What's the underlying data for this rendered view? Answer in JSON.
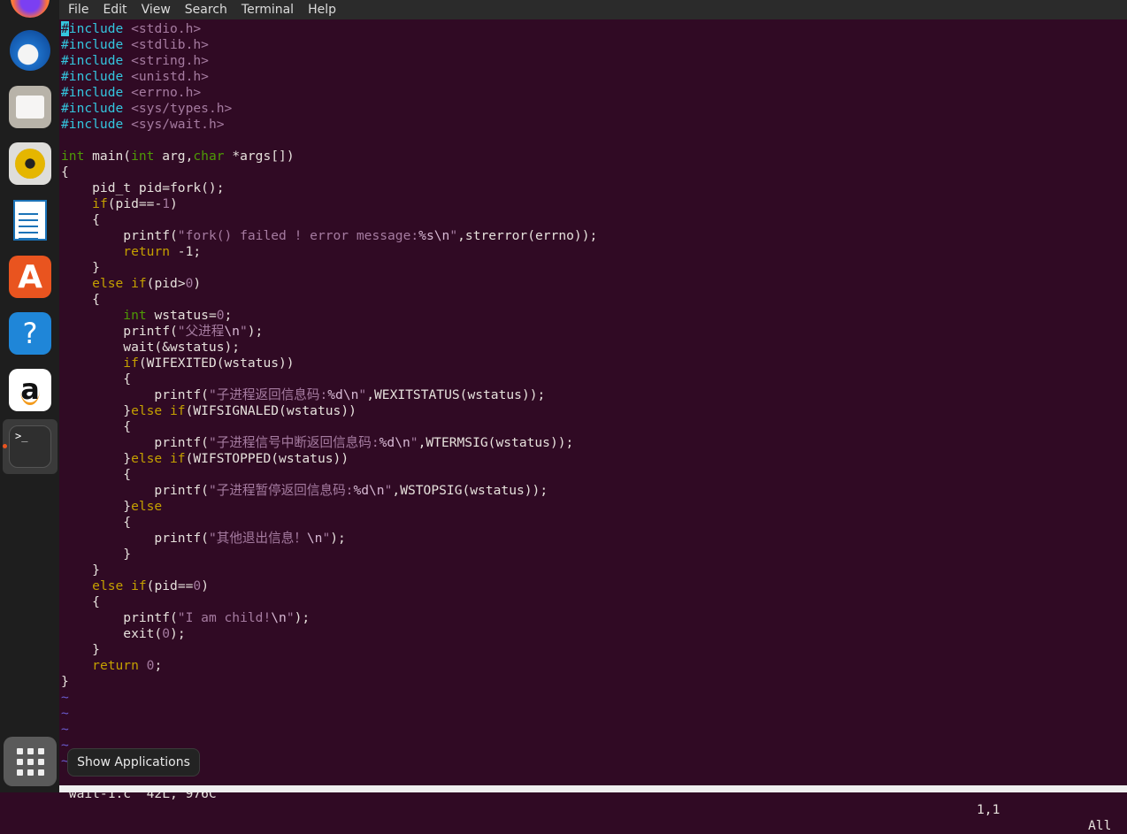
{
  "menubar": {
    "items": [
      "File",
      "Edit",
      "View",
      "Search",
      "Terminal",
      "Help"
    ]
  },
  "dock": {
    "items": [
      {
        "name": "firefox",
        "icon": "firefox-icon"
      },
      {
        "name": "thunderbird",
        "icon": "thunderbird-mail-icon"
      },
      {
        "name": "files",
        "icon": "folder-icon"
      },
      {
        "name": "rhythmbox",
        "icon": "speaker-icon"
      },
      {
        "name": "libreoffice-writer",
        "icon": "document-icon"
      },
      {
        "name": "ubuntu-software",
        "icon": "app-store-icon"
      },
      {
        "name": "help",
        "icon": "question-mark-icon"
      },
      {
        "name": "amazon",
        "icon": "amazon-icon"
      },
      {
        "name": "terminal",
        "icon": "terminal-icon",
        "active": true
      }
    ],
    "show_apps_tooltip": "Show Applications",
    "terminal_glyph": ">_",
    "help_glyph": "?",
    "amazon_glyph": "a"
  },
  "editor": {
    "lines": [
      [
        [
          "cur",
          "#"
        ],
        [
          "p",
          "include"
        ],
        [
          "",
          " "
        ],
        [
          "h",
          "<stdio.h>"
        ]
      ],
      [
        [
          "p",
          "#include"
        ],
        [
          "",
          " "
        ],
        [
          "h",
          "<stdlib.h>"
        ]
      ],
      [
        [
          "p",
          "#include"
        ],
        [
          "",
          " "
        ],
        [
          "h",
          "<string.h>"
        ]
      ],
      [
        [
          "p",
          "#include"
        ],
        [
          "",
          " "
        ],
        [
          "h",
          "<unistd.h>"
        ]
      ],
      [
        [
          "p",
          "#include"
        ],
        [
          "",
          " "
        ],
        [
          "h",
          "<errno.h>"
        ]
      ],
      [
        [
          "p",
          "#include"
        ],
        [
          "",
          " "
        ],
        [
          "h",
          "<sys/types.h>"
        ]
      ],
      [
        [
          "p",
          "#include"
        ],
        [
          "",
          " "
        ],
        [
          "h",
          "<sys/wait.h>"
        ]
      ],
      [],
      [
        [
          "t",
          "int"
        ],
        [
          "",
          " main("
        ],
        [
          "t",
          "int"
        ],
        [
          "",
          " arg,"
        ],
        [
          "t",
          "char"
        ],
        [
          "",
          " *args[])"
        ]
      ],
      [
        [
          "",
          "{"
        ]
      ],
      [
        [
          "",
          "    pid_t pid=fork();"
        ]
      ],
      [
        [
          "",
          "    "
        ],
        [
          "k",
          "if"
        ],
        [
          "",
          "(pid==-"
        ],
        [
          "n",
          "1"
        ],
        [
          "",
          ")"
        ]
      ],
      [
        [
          "",
          "    {"
        ]
      ],
      [
        [
          "",
          "        printf("
        ],
        [
          "h",
          "\"fork() failed ! error message:"
        ],
        [
          "s",
          "%s\\n"
        ],
        [
          "h",
          "\""
        ],
        [
          "",
          ",strerror(errno));"
        ]
      ],
      [
        [
          "",
          "        "
        ],
        [
          "k",
          "return"
        ],
        [
          "",
          " -1;"
        ]
      ],
      [
        [
          "",
          "    }"
        ]
      ],
      [
        [
          "",
          "    "
        ],
        [
          "k",
          "else if"
        ],
        [
          "",
          "(pid>"
        ],
        [
          "n",
          "0"
        ],
        [
          "",
          ")"
        ]
      ],
      [
        [
          "",
          "    {"
        ]
      ],
      [
        [
          "",
          "        "
        ],
        [
          "t",
          "int"
        ],
        [
          "",
          " wstatus="
        ],
        [
          "n",
          "0"
        ],
        [
          "",
          ";"
        ]
      ],
      [
        [
          "",
          "        printf("
        ],
        [
          "h",
          "\"父进程"
        ],
        [
          "s",
          "\\n"
        ],
        [
          "h",
          "\""
        ],
        [
          "",
          ");"
        ]
      ],
      [
        [
          "",
          "        wait(&wstatus);"
        ]
      ],
      [
        [
          "",
          "        "
        ],
        [
          "k",
          "if"
        ],
        [
          "",
          "(WIFEXITED(wstatus))"
        ]
      ],
      [
        [
          "",
          "        {"
        ]
      ],
      [
        [
          "",
          "            printf("
        ],
        [
          "h",
          "\"子进程返回信息码:"
        ],
        [
          "s",
          "%d\\n"
        ],
        [
          "h",
          "\""
        ],
        [
          "",
          ",WEXITSTATUS(wstatus));"
        ]
      ],
      [
        [
          "",
          "        }"
        ],
        [
          "k",
          "else if"
        ],
        [
          "",
          "(WIFSIGNALED(wstatus))"
        ]
      ],
      [
        [
          "",
          "        {"
        ]
      ],
      [
        [
          "",
          "            printf("
        ],
        [
          "h",
          "\"子进程信号中断返回信息码:"
        ],
        [
          "s",
          "%d\\n"
        ],
        [
          "h",
          "\""
        ],
        [
          "",
          ",WTERMSIG(wstatus));"
        ]
      ],
      [
        [
          "",
          "        }"
        ],
        [
          "k",
          "else if"
        ],
        [
          "",
          "(WIFSTOPPED(wstatus))"
        ]
      ],
      [
        [
          "",
          "        {"
        ]
      ],
      [
        [
          "",
          "            printf("
        ],
        [
          "h",
          "\"子进程暂停返回信息码:"
        ],
        [
          "s",
          "%d\\n"
        ],
        [
          "h",
          "\""
        ],
        [
          "",
          ",WSTOPSIG(wstatus));"
        ]
      ],
      [
        [
          "",
          "        }"
        ],
        [
          "k",
          "else"
        ]
      ],
      [
        [
          "",
          "        {"
        ]
      ],
      [
        [
          "",
          "            printf("
        ],
        [
          "h",
          "\"其他退出信息！"
        ],
        [
          "s",
          "\\n"
        ],
        [
          "h",
          "\""
        ],
        [
          "",
          ");"
        ]
      ],
      [
        [
          "",
          "        }"
        ]
      ],
      [
        [
          "",
          "    }"
        ]
      ],
      [
        [
          "",
          "    "
        ],
        [
          "k",
          "else if"
        ],
        [
          "",
          "(pid=="
        ],
        [
          "n",
          "0"
        ],
        [
          "",
          ")"
        ]
      ],
      [
        [
          "",
          "    {"
        ]
      ],
      [
        [
          "",
          "        printf("
        ],
        [
          "h",
          "\"I am child!"
        ],
        [
          "s",
          "\\n"
        ],
        [
          "h",
          "\""
        ],
        [
          "",
          ");"
        ]
      ],
      [
        [
          "",
          "        exit("
        ],
        [
          "n",
          "0"
        ],
        [
          "",
          ");"
        ]
      ],
      [
        [
          "",
          "    }"
        ]
      ],
      [
        [
          "",
          "    "
        ],
        [
          "k",
          "return"
        ],
        [
          "",
          " "
        ],
        [
          "n",
          "0"
        ],
        [
          "",
          ";"
        ]
      ],
      [
        [
          "",
          "}"
        ]
      ],
      [
        [
          "tilde",
          "~"
        ]
      ],
      [
        [
          "tilde",
          "~"
        ]
      ],
      [
        [
          "tilde",
          "~"
        ]
      ],
      [
        [
          "tilde",
          "~"
        ]
      ],
      [
        [
          "tilde",
          "~"
        ]
      ]
    ]
  },
  "status": {
    "file_info": "\"wait-1.c\" 42L, 976C",
    "position": "1,1",
    "scroll": "All"
  }
}
